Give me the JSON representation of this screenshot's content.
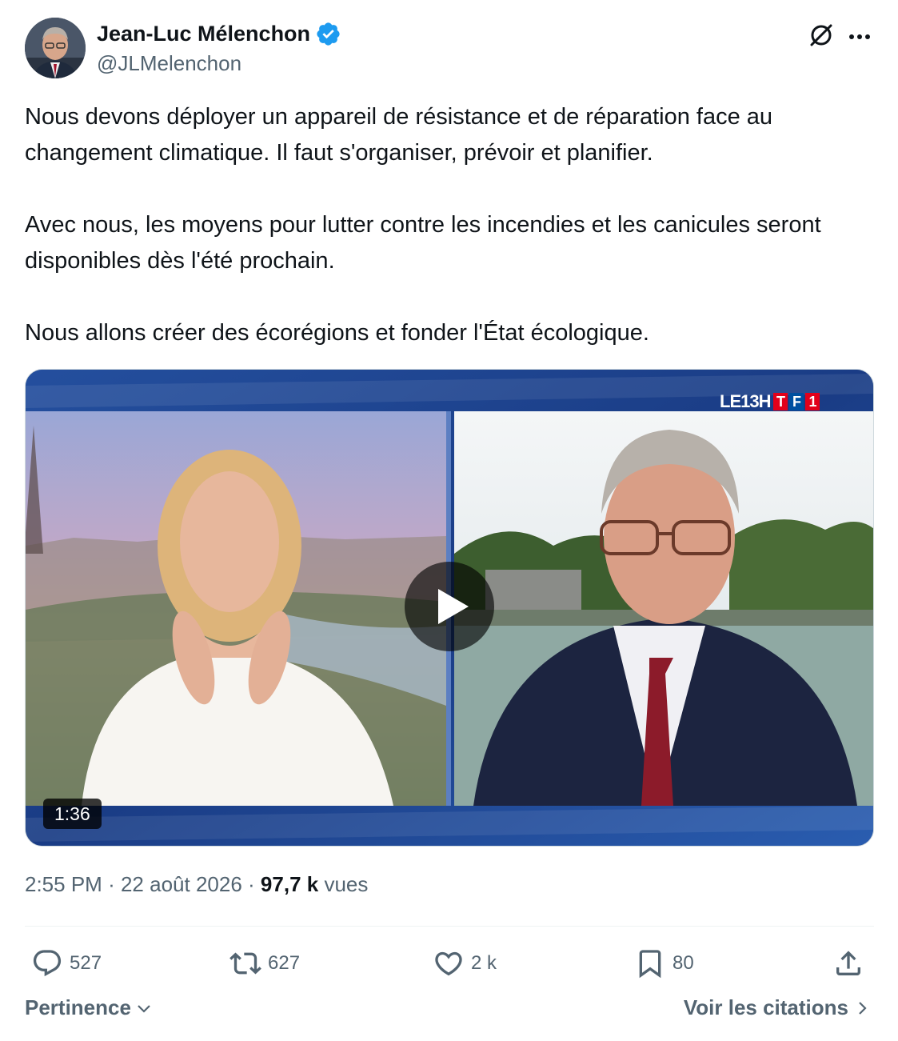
{
  "author": {
    "name": "Jean-Luc Mélenchon",
    "handle": "@JLMelenchon",
    "verified": true
  },
  "tweet": {
    "paragraphs": [
      "Nous devons déployer un appareil de résistance et de réparation face au changement climatique. Il faut s'organiser, prévoir et planifier.",
      "Avec nous, les moyens pour lutter contre les incendies et les canicules seront disponibles dès l'été prochain.",
      "Nous allons créer des écorégions et fonder l'État écologique."
    ]
  },
  "video": {
    "duration": "1:36",
    "channel_prefix": "LE13H",
    "channel_letters": [
      "T",
      "F",
      "1"
    ],
    "channel_colors": [
      "#e2001a",
      "#0050a0",
      "#e2001a"
    ]
  },
  "meta": {
    "time": "2:55 PM",
    "separator": "·",
    "date": "22 août 2026",
    "views_count": "97,7 k",
    "views_label": "vues"
  },
  "actions": {
    "replies": "527",
    "retweets": "627",
    "likes": "2 k",
    "bookmarks": "80"
  },
  "footer": {
    "sort_label": "Pertinence",
    "quotes_label": "Voir les citations"
  },
  "icons": [
    "verified-badge-icon",
    "grok-icon",
    "more-icon",
    "play-icon",
    "reply-icon",
    "retweet-icon",
    "like-icon",
    "bookmark-icon",
    "share-icon",
    "chevron-down-icon",
    "chevron-right-icon"
  ],
  "colors": {
    "text": "#0f1419",
    "secondary": "#536471",
    "verified": "#1d9bf0",
    "divider": "#eff3f4"
  }
}
